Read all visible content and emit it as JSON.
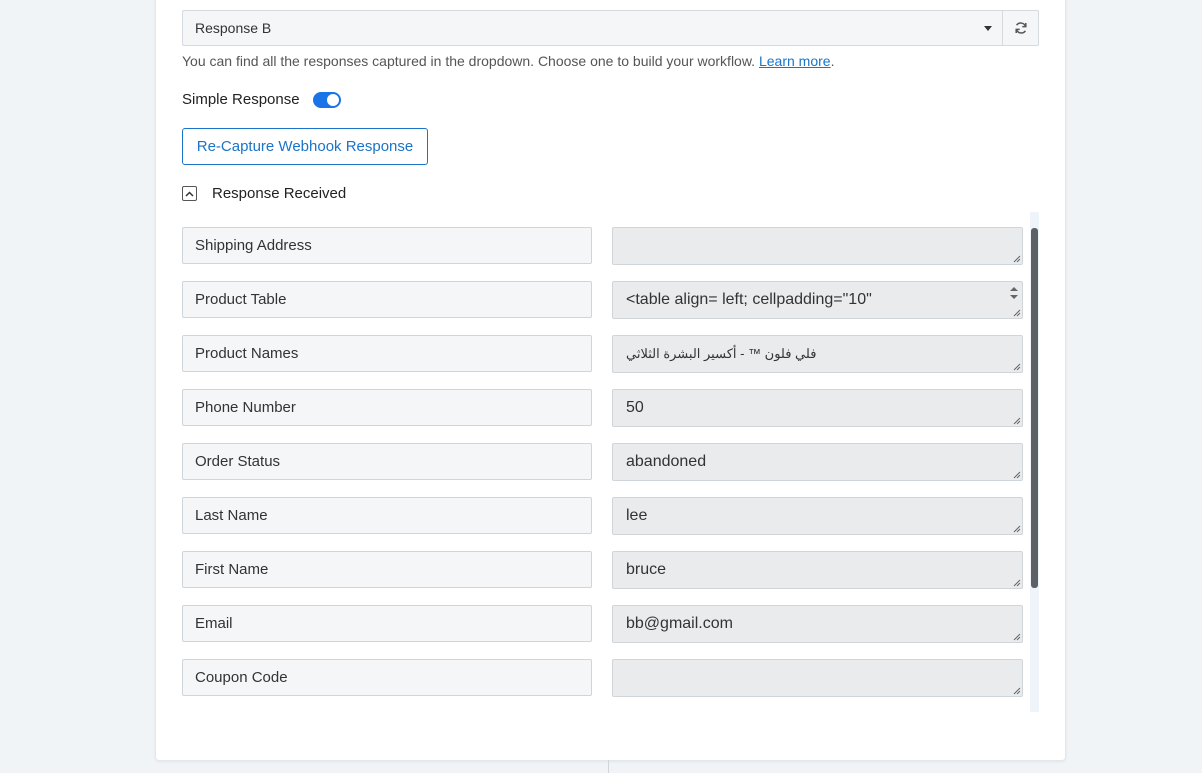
{
  "response_select": {
    "value": "Response B"
  },
  "help": {
    "text": "You can find all the responses captured in the dropdown. Choose one to build your workflow.",
    "link": "Learn more",
    "period": "."
  },
  "simple_response": {
    "label": "Simple Response",
    "enabled": true
  },
  "recapture_button": {
    "label": "Re-Capture Webhook Response"
  },
  "response_received": {
    "label": "Response Received"
  },
  "fields": [
    {
      "key": "Shipping Address",
      "value": ""
    },
    {
      "key": "Product Table",
      "value": "<table align= left; cellpadding=\"10\""
    },
    {
      "key": "Product Names",
      "value": "فلي فلون ™ - أكسير البشرة الثلاثي"
    },
    {
      "key": "Phone Number",
      "value": "50"
    },
    {
      "key": "Order Status",
      "value": "abandoned"
    },
    {
      "key": "Last Name",
      "value": "lee"
    },
    {
      "key": "First Name",
      "value": "bruce"
    },
    {
      "key": "Email",
      "value": "bb@gmail.com"
    },
    {
      "key": "Coupon Code",
      "value": ""
    }
  ],
  "colors": {
    "accent": "#1a74c9",
    "toggle": "#1a74e8",
    "background": "#f1f4f7"
  },
  "icons": [
    "caret-down-icon",
    "refresh-icon",
    "chevron-up-icon",
    "resize-grip-icon",
    "spinner-arrows-icon"
  ]
}
